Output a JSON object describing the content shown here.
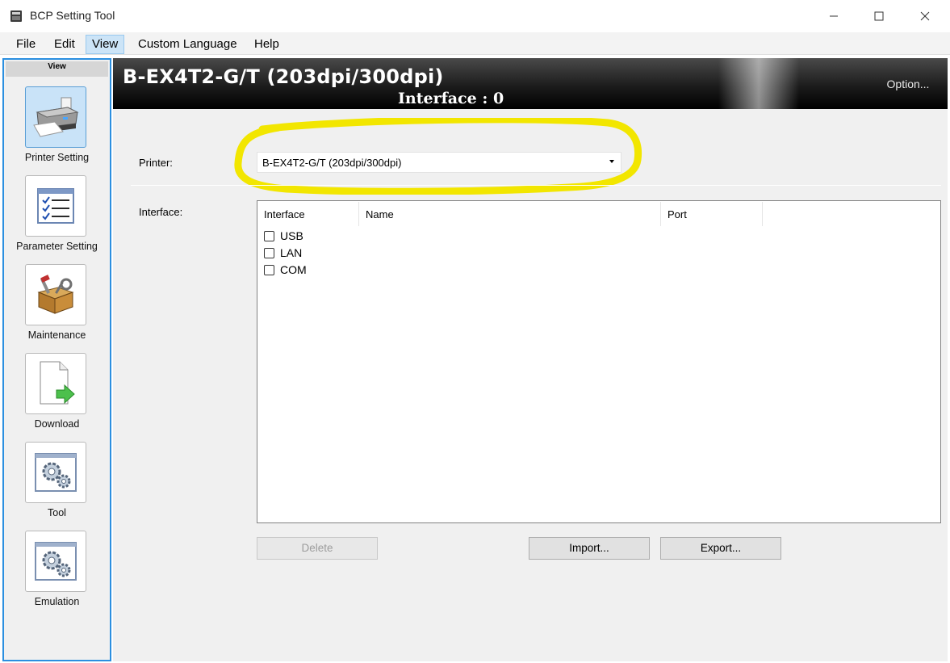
{
  "window": {
    "title": "BCP Setting Tool"
  },
  "menu": {
    "items": [
      "File",
      "Edit",
      "View",
      "Custom Language",
      "Help"
    ],
    "active": "View"
  },
  "view_panel": {
    "header": "View",
    "items": [
      {
        "label": "Printer Setting",
        "icon": "printer-icon",
        "selected": true
      },
      {
        "label": "Parameter Setting",
        "icon": "checklist-icon",
        "selected": false
      },
      {
        "label": "Maintenance",
        "icon": "toolbox-icon",
        "selected": false
      },
      {
        "label": "Download",
        "icon": "document-download-icon",
        "selected": false
      },
      {
        "label": "Tool",
        "icon": "gears-icon",
        "selected": false
      },
      {
        "label": "Emulation",
        "icon": "gears-icon",
        "selected": false
      }
    ]
  },
  "header": {
    "model": "B-EX4T2-G/T (203dpi/300dpi)",
    "interface": "Interface : 0",
    "option_label": "Option..."
  },
  "form": {
    "printer_label": "Printer:",
    "printer_value": "B-EX4T2-G/T (203dpi/300dpi)",
    "interface_label": "Interface:",
    "table": {
      "columns": [
        "Interface",
        "Name",
        "Port"
      ],
      "options": [
        {
          "label": "USB",
          "checked": false
        },
        {
          "label": "LAN",
          "checked": false
        },
        {
          "label": "COM",
          "checked": false
        }
      ]
    },
    "buttons": {
      "delete": "Delete",
      "import": "Import...",
      "export": "Export..."
    }
  },
  "colors": {
    "highlight": "#f2e600",
    "selection": "#c9e3f8",
    "panel_border": "#2b8fe0"
  }
}
